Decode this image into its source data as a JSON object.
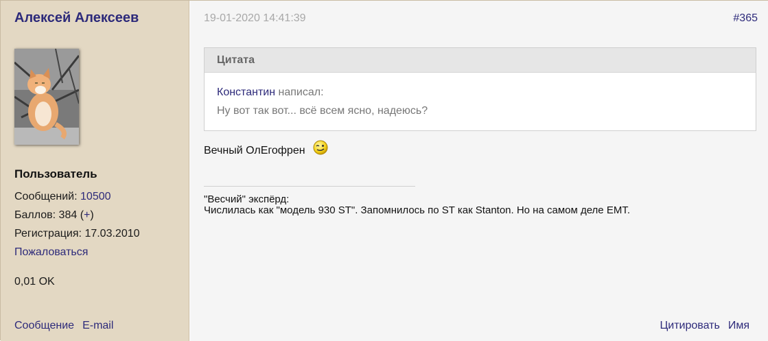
{
  "author": {
    "name": "Алексей Алексеев",
    "avatar_alt": "cat-avatar",
    "rank": "Пользователь",
    "messages_label": "Сообщений:",
    "messages_count": "10500",
    "points_label": "Баллов:",
    "points_value": "384",
    "points_plus_open": "(",
    "points_plus": "+",
    "points_plus_close": ")",
    "registration_label": "Регистрация:",
    "registration_date": "17.03.2010",
    "report_link": "Пожаловаться",
    "status_text": "0,01 OK",
    "message_link": "Сообщение",
    "email_link": "E-mail"
  },
  "post": {
    "date": "19-01-2020 14:41:39",
    "number": "#365",
    "quote": {
      "header": "Цитата",
      "author": "Константин",
      "wrote": "написал:",
      "text": "Ну вот так вот... всё всем ясно, надеюсь?"
    },
    "body_text": "Вечный ОлЕгофрен",
    "smiley_icon": "wink-smiley-icon",
    "signature_line1": "\"Весчий\" экспёрд:",
    "signature_line2": "Числилась как \"модель 930 ST\". Запомнилось по ST как Stanton. Но на самом деле EMT.",
    "quote_link": "Цитировать",
    "name_link": "Имя"
  },
  "colors": {
    "sidebar_bg": "#e3d8c3",
    "content_bg": "#f5f5f5",
    "link": "#2d2a7a",
    "author_name": "#1d1d5c",
    "muted": "#a8a8a8"
  }
}
